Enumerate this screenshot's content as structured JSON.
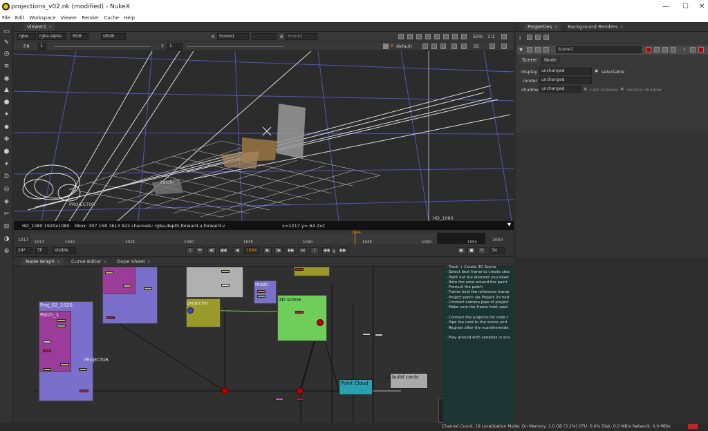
{
  "window": {
    "title": "projections_v02.nk (modified) - NukeX",
    "controls": {
      "minimize": "—",
      "maximize": "☐",
      "close": "✕"
    }
  },
  "menu": [
    "File",
    "Edit",
    "Workspace",
    "Viewer",
    "Render",
    "Cache",
    "Help"
  ],
  "viewer": {
    "tab": "Viewer1",
    "channels": "rgba",
    "channel_alpha": "rgba.alpha",
    "colorspace_mode": "RGB",
    "lut": "sRGB",
    "input_a_label": "A",
    "input_a": "Scene1",
    "input_a_op": "-",
    "input_b_label": "B",
    "input_b": "Scene1",
    "zoom": "50%",
    "ratio": "1:1",
    "fstop": "f/8",
    "gain": "1",
    "gamma_label": "Y",
    "gamma": "1",
    "camera": "default",
    "view_mode": "3D",
    "overlay_labels": {
      "format_corner": "HD_1080",
      "projector_label": "PROJECTOR",
      "card_label": "Patch"
    },
    "info": {
      "format": "HD_1080 1920x1080",
      "bbox": "bbox: 307 158 1613 922 channels: rgba,depth,forward.u,forward.v",
      "coords": "x=1217 y=-64 2x2"
    }
  },
  "timeline": {
    "start": "1017",
    "end": "1050",
    "ticks": [
      "1017",
      "1020",
      "1025",
      "1030",
      "1035",
      "1040",
      "1045",
      "1050",
      "1054"
    ],
    "current": "1044",
    "fps": "24*",
    "tf": "TF",
    "visible": "Visible",
    "step": "8",
    "frame_field": "1044",
    "end_field": "34"
  },
  "properties": {
    "tabs": [
      "Properties",
      "Background Renders"
    ],
    "node_name": "Scene1",
    "subtabs": [
      "Scene",
      "Node"
    ],
    "rows": [
      {
        "label": "display",
        "value": "unchanged",
        "check": "selectable"
      },
      {
        "label": "render",
        "value": "unchanged"
      },
      {
        "label": "shadow",
        "value": "unchanged",
        "check1": "cast shadow",
        "check2": "receive shadow"
      }
    ],
    "max_panels": "1"
  },
  "nodegraph": {
    "tabs": [
      "Node Graph",
      "Curve Editor",
      "Dope Sheet"
    ],
    "nodes": {
      "proj_label": "Proj_02_1020",
      "patch_label": "Patch_1",
      "projector_bd": "PROJECTOR",
      "projector": "projector",
      "mask": "mask",
      "scene": "3D scene",
      "point_cloud": "Point Cloud",
      "build_cards": "build cards"
    },
    "notes": [
      "- Track + Create 3D Scene",
      "- Select best frame to create clea",
      "- Paint out the element you need",
      "- Roto the area around the paint",
      "- Premult the patch",
      "- Frame hold the reference frame",
      "- Project patch via Project 2d nod",
      "- Connect camera pipe of project",
      "- Make sure the frame hold used",
      "",
      "- Connect the projector3d node t",
      "- Pipe the card to the scene and",
      "- Regrain after the scanlinerende",
      "",
      "- Play around with samples in sca"
    ]
  },
  "status": "Channel Count: 19  Localization Mode: On  Memory: 1.0 GB (3.2%)  CPU: 0.0%  Disk: 0.0 MB/s  Network: 0.0 MB/s",
  "colors": {
    "backdrop_purple": "#7b6fcc",
    "backdrop_magenta": "#9b3c9b",
    "backdrop_green": "#6fce5a",
    "backdrop_olive": "#9a9a2a",
    "note_teal": "#1c3532",
    "accent_orange": "#e88a00"
  }
}
